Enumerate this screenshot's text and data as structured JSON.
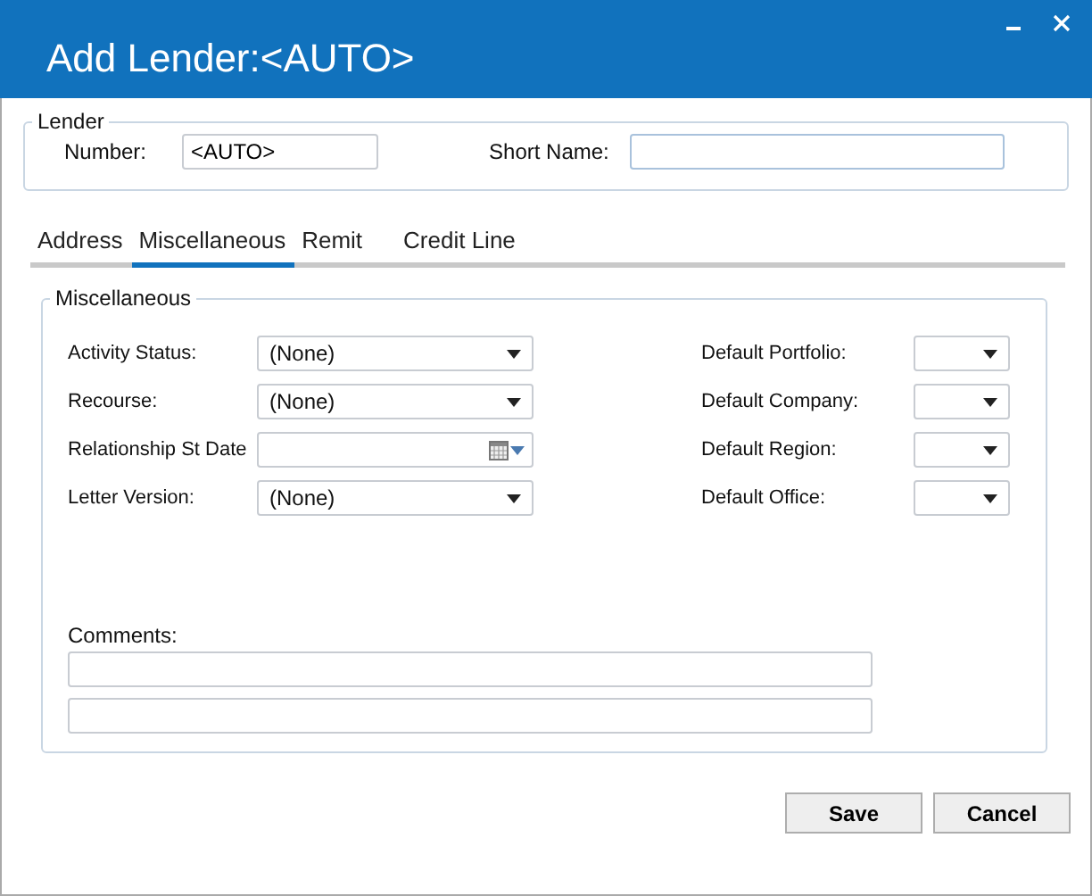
{
  "window": {
    "title": "Add Lender:<AUTO>"
  },
  "lender": {
    "legend": "Lender",
    "number": {
      "label": "Number:",
      "value": "<AUTO>"
    },
    "short_name": {
      "label": "Short Name:"
    }
  },
  "tabs": [
    {
      "label": "Address",
      "selected": false
    },
    {
      "label": "Miscellaneous",
      "selected": true
    },
    {
      "label": "Remit",
      "selected": false
    },
    {
      "label": "Credit Line",
      "selected": false
    }
  ],
  "misc": {
    "legend": "Miscellaneous",
    "left_fields": [
      {
        "label": "Activity Status:",
        "kind": "dropdown",
        "value": "(None)"
      },
      {
        "label": "Recourse:",
        "kind": "dropdown",
        "value": "(None)"
      },
      {
        "label": "Relationship St Date",
        "kind": "date"
      },
      {
        "label": "Letter Version:",
        "kind": "dropdown",
        "value": "(None)"
      }
    ],
    "right_fields": [
      {
        "label": "Default Portfolio:",
        "kind": "dropdown"
      },
      {
        "label": "Default Company:",
        "kind": "dropdown"
      },
      {
        "label": "Default Region:",
        "kind": "dropdown"
      },
      {
        "label": "Default Office:",
        "kind": "dropdown"
      }
    ],
    "comments": {
      "label": "Comments:"
    }
  },
  "buttons": [
    "Save",
    "Cancel"
  ]
}
